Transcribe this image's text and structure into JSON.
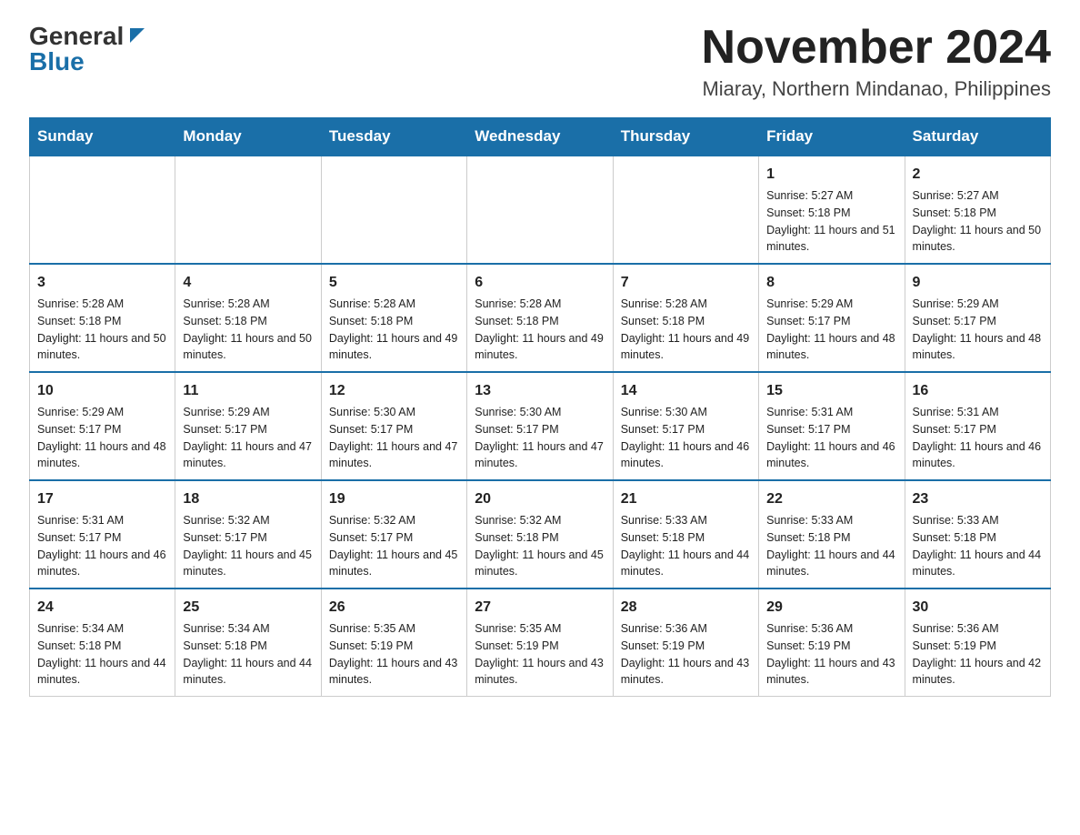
{
  "header": {
    "logo_general": "General",
    "logo_blue": "Blue",
    "month_title": "November 2024",
    "location": "Miaray, Northern Mindanao, Philippines"
  },
  "weekdays": [
    "Sunday",
    "Monday",
    "Tuesday",
    "Wednesday",
    "Thursday",
    "Friday",
    "Saturday"
  ],
  "weeks": [
    [
      {
        "day": "",
        "sunrise": "",
        "sunset": "",
        "daylight": ""
      },
      {
        "day": "",
        "sunrise": "",
        "sunset": "",
        "daylight": ""
      },
      {
        "day": "",
        "sunrise": "",
        "sunset": "",
        "daylight": ""
      },
      {
        "day": "",
        "sunrise": "",
        "sunset": "",
        "daylight": ""
      },
      {
        "day": "",
        "sunrise": "",
        "sunset": "",
        "daylight": ""
      },
      {
        "day": "1",
        "sunrise": "Sunrise: 5:27 AM",
        "sunset": "Sunset: 5:18 PM",
        "daylight": "Daylight: 11 hours and 51 minutes."
      },
      {
        "day": "2",
        "sunrise": "Sunrise: 5:27 AM",
        "sunset": "Sunset: 5:18 PM",
        "daylight": "Daylight: 11 hours and 50 minutes."
      }
    ],
    [
      {
        "day": "3",
        "sunrise": "Sunrise: 5:28 AM",
        "sunset": "Sunset: 5:18 PM",
        "daylight": "Daylight: 11 hours and 50 minutes."
      },
      {
        "day": "4",
        "sunrise": "Sunrise: 5:28 AM",
        "sunset": "Sunset: 5:18 PM",
        "daylight": "Daylight: 11 hours and 50 minutes."
      },
      {
        "day": "5",
        "sunrise": "Sunrise: 5:28 AM",
        "sunset": "Sunset: 5:18 PM",
        "daylight": "Daylight: 11 hours and 49 minutes."
      },
      {
        "day": "6",
        "sunrise": "Sunrise: 5:28 AM",
        "sunset": "Sunset: 5:18 PM",
        "daylight": "Daylight: 11 hours and 49 minutes."
      },
      {
        "day": "7",
        "sunrise": "Sunrise: 5:28 AM",
        "sunset": "Sunset: 5:18 PM",
        "daylight": "Daylight: 11 hours and 49 minutes."
      },
      {
        "day": "8",
        "sunrise": "Sunrise: 5:29 AM",
        "sunset": "Sunset: 5:17 PM",
        "daylight": "Daylight: 11 hours and 48 minutes."
      },
      {
        "day": "9",
        "sunrise": "Sunrise: 5:29 AM",
        "sunset": "Sunset: 5:17 PM",
        "daylight": "Daylight: 11 hours and 48 minutes."
      }
    ],
    [
      {
        "day": "10",
        "sunrise": "Sunrise: 5:29 AM",
        "sunset": "Sunset: 5:17 PM",
        "daylight": "Daylight: 11 hours and 48 minutes."
      },
      {
        "day": "11",
        "sunrise": "Sunrise: 5:29 AM",
        "sunset": "Sunset: 5:17 PM",
        "daylight": "Daylight: 11 hours and 47 minutes."
      },
      {
        "day": "12",
        "sunrise": "Sunrise: 5:30 AM",
        "sunset": "Sunset: 5:17 PM",
        "daylight": "Daylight: 11 hours and 47 minutes."
      },
      {
        "day": "13",
        "sunrise": "Sunrise: 5:30 AM",
        "sunset": "Sunset: 5:17 PM",
        "daylight": "Daylight: 11 hours and 47 minutes."
      },
      {
        "day": "14",
        "sunrise": "Sunrise: 5:30 AM",
        "sunset": "Sunset: 5:17 PM",
        "daylight": "Daylight: 11 hours and 46 minutes."
      },
      {
        "day": "15",
        "sunrise": "Sunrise: 5:31 AM",
        "sunset": "Sunset: 5:17 PM",
        "daylight": "Daylight: 11 hours and 46 minutes."
      },
      {
        "day": "16",
        "sunrise": "Sunrise: 5:31 AM",
        "sunset": "Sunset: 5:17 PM",
        "daylight": "Daylight: 11 hours and 46 minutes."
      }
    ],
    [
      {
        "day": "17",
        "sunrise": "Sunrise: 5:31 AM",
        "sunset": "Sunset: 5:17 PM",
        "daylight": "Daylight: 11 hours and 46 minutes."
      },
      {
        "day": "18",
        "sunrise": "Sunrise: 5:32 AM",
        "sunset": "Sunset: 5:17 PM",
        "daylight": "Daylight: 11 hours and 45 minutes."
      },
      {
        "day": "19",
        "sunrise": "Sunrise: 5:32 AM",
        "sunset": "Sunset: 5:17 PM",
        "daylight": "Daylight: 11 hours and 45 minutes."
      },
      {
        "day": "20",
        "sunrise": "Sunrise: 5:32 AM",
        "sunset": "Sunset: 5:18 PM",
        "daylight": "Daylight: 11 hours and 45 minutes."
      },
      {
        "day": "21",
        "sunrise": "Sunrise: 5:33 AM",
        "sunset": "Sunset: 5:18 PM",
        "daylight": "Daylight: 11 hours and 44 minutes."
      },
      {
        "day": "22",
        "sunrise": "Sunrise: 5:33 AM",
        "sunset": "Sunset: 5:18 PM",
        "daylight": "Daylight: 11 hours and 44 minutes."
      },
      {
        "day": "23",
        "sunrise": "Sunrise: 5:33 AM",
        "sunset": "Sunset: 5:18 PM",
        "daylight": "Daylight: 11 hours and 44 minutes."
      }
    ],
    [
      {
        "day": "24",
        "sunrise": "Sunrise: 5:34 AM",
        "sunset": "Sunset: 5:18 PM",
        "daylight": "Daylight: 11 hours and 44 minutes."
      },
      {
        "day": "25",
        "sunrise": "Sunrise: 5:34 AM",
        "sunset": "Sunset: 5:18 PM",
        "daylight": "Daylight: 11 hours and 44 minutes."
      },
      {
        "day": "26",
        "sunrise": "Sunrise: 5:35 AM",
        "sunset": "Sunset: 5:19 PM",
        "daylight": "Daylight: 11 hours and 43 minutes."
      },
      {
        "day": "27",
        "sunrise": "Sunrise: 5:35 AM",
        "sunset": "Sunset: 5:19 PM",
        "daylight": "Daylight: 11 hours and 43 minutes."
      },
      {
        "day": "28",
        "sunrise": "Sunrise: 5:36 AM",
        "sunset": "Sunset: 5:19 PM",
        "daylight": "Daylight: 11 hours and 43 minutes."
      },
      {
        "day": "29",
        "sunrise": "Sunrise: 5:36 AM",
        "sunset": "Sunset: 5:19 PM",
        "daylight": "Daylight: 11 hours and 43 minutes."
      },
      {
        "day": "30",
        "sunrise": "Sunrise: 5:36 AM",
        "sunset": "Sunset: 5:19 PM",
        "daylight": "Daylight: 11 hours and 42 minutes."
      }
    ]
  ]
}
